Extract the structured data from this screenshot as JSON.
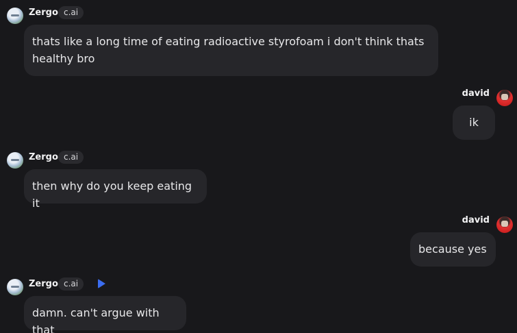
{
  "bot": {
    "name": "Zergo",
    "tag": "c.ai",
    "avatar_icon": "airplane-sky-avatar"
  },
  "user": {
    "name": "david",
    "avatar_icon": "red-portrait-avatar"
  },
  "messages": [
    {
      "sender": "bot",
      "text": "thats like a long time of eating radioactive styrofoam i don't think thats healthy bro"
    },
    {
      "sender": "user",
      "text": "ik"
    },
    {
      "sender": "bot",
      "text": "then why do you keep eating it"
    },
    {
      "sender": "user",
      "text": "because yes"
    },
    {
      "sender": "bot",
      "text": "damn. can't argue with that",
      "has_play": true
    }
  ],
  "accent": "#3b6df0"
}
